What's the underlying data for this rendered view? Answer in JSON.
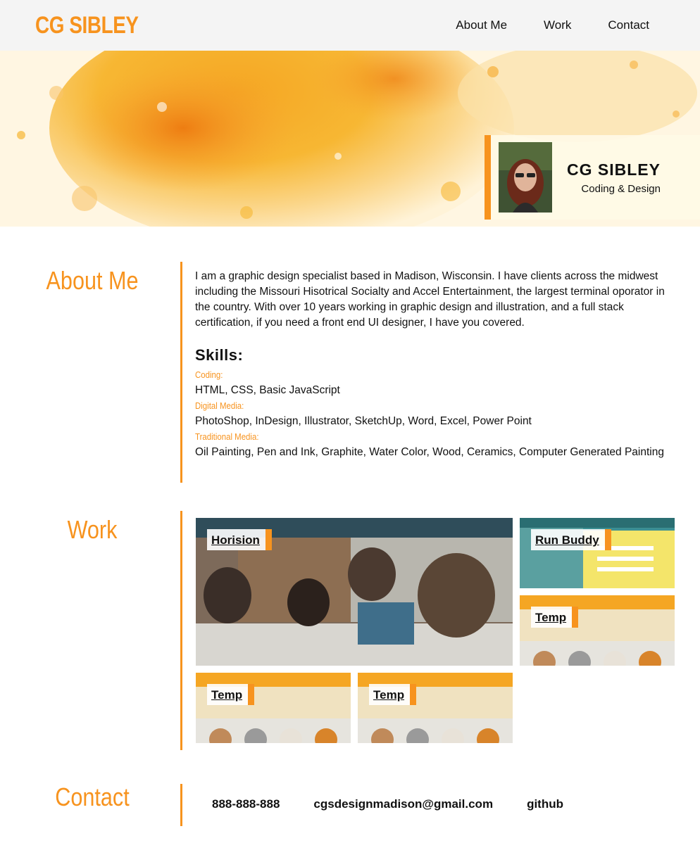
{
  "header": {
    "logo": "CG SIBLEY",
    "nav": [
      "About Me",
      "Work",
      "Contact"
    ]
  },
  "hero": {
    "name": "CG SIBLEY",
    "tagline": "Coding & Design"
  },
  "about": {
    "title": "About Me",
    "bio": "I am a graphic design specialist based in Madison, Wisconsin. I have clients across the midwest including the Missouri Hisotrical Socialty and Accel Entertainment, the largest terminal oporator in the country. With over 10 years working in graphic design and illustration, and a full stack certification, if you need a front end UI designer, I have you covered.",
    "skills_title": "Skills:",
    "skills": [
      {
        "label": "Coding:",
        "value": "HTML, CSS, Basic JavaScript"
      },
      {
        "label": "Digital Media:",
        "value": "PhotoShop, InDesign, Illustrator, SketchUp, Word, Excel, Power Point"
      },
      {
        "label": "Traditional Media:",
        "value": "Oil Painting, Pen and Ink, Graphite, Water Color, Wood, Ceramics, Computer Generated Painting"
      }
    ]
  },
  "work": {
    "title": "Work",
    "projects": [
      {
        "label": "Horision"
      },
      {
        "label": "Run Buddy"
      },
      {
        "label": "Temp"
      },
      {
        "label": "Temp"
      },
      {
        "label": "Temp"
      }
    ]
  },
  "contact": {
    "title": "Contact",
    "phone": "888-888-888",
    "email": "cgsdesignmadison@gmail.com",
    "github": "github"
  },
  "colors": {
    "accent": "#f7931e",
    "header_bg": "#f4f4f4",
    "text": "#111111"
  }
}
